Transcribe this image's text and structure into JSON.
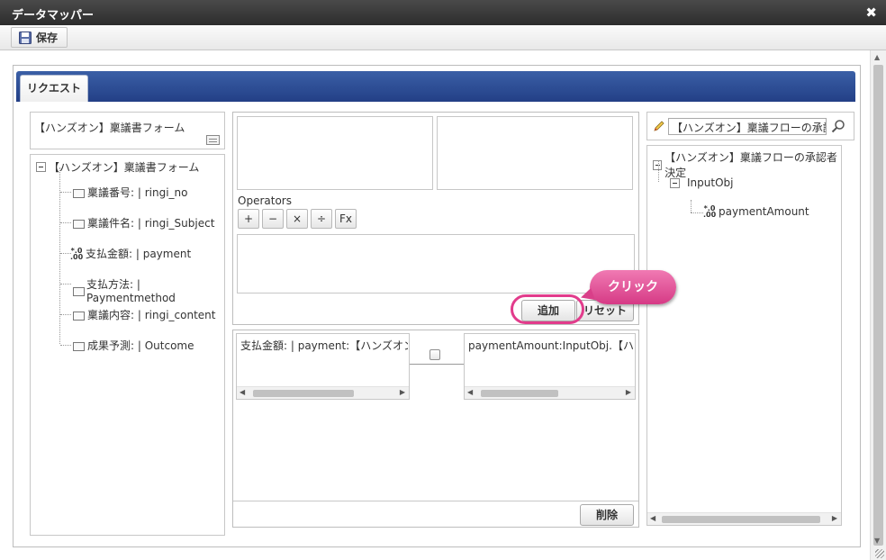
{
  "window": {
    "title": "データマッパー"
  },
  "toolbar": {
    "save_label": "保存"
  },
  "tabs": [
    {
      "label": "リクエスト"
    }
  ],
  "source": {
    "form_name": "【ハンズオン】稟議書フォーム",
    "tree_root": "【ハンズオン】稟議書フォーム",
    "fields": [
      {
        "label": "稟議番号: | ringi_no",
        "icon": "field-icon"
      },
      {
        "label": "稟議件名: | ringi_Subject",
        "icon": "field-icon"
      },
      {
        "label": "支払金額: | payment",
        "icon": "number-icon"
      },
      {
        "label": "支払方法: | Paymentmethod",
        "icon": "field-icon"
      },
      {
        "label": "稟議内容: | ringi_content",
        "icon": "field-icon"
      },
      {
        "label": "成果予測: | Outcome",
        "icon": "field-icon"
      }
    ]
  },
  "expression": {
    "operators_label": "Operators",
    "operators": [
      "+",
      "−",
      "×",
      "÷",
      "Fx"
    ],
    "add_label": "追加",
    "reset_label": "リセット"
  },
  "mapping": {
    "rows": [
      {
        "source": "支払金額: | payment:【ハンズオン】稟議書フォーム",
        "target": "paymentAmount:InputObj.【ハンズオン】稟議フロー"
      }
    ],
    "delete_label": "削除"
  },
  "target": {
    "search_value": "【ハンズオン】稟議フローの承認者",
    "tree_root": "【ハンズオン】稟議フローの承認者決定",
    "node": "InputObj",
    "leaf": "paymentAmount"
  },
  "annotation": {
    "callout_label": "クリック",
    "accent_color": "#e23c8c"
  },
  "colors": {
    "tab_bar": "#2f4f95",
    "title_bar": "#3a3a3a"
  }
}
